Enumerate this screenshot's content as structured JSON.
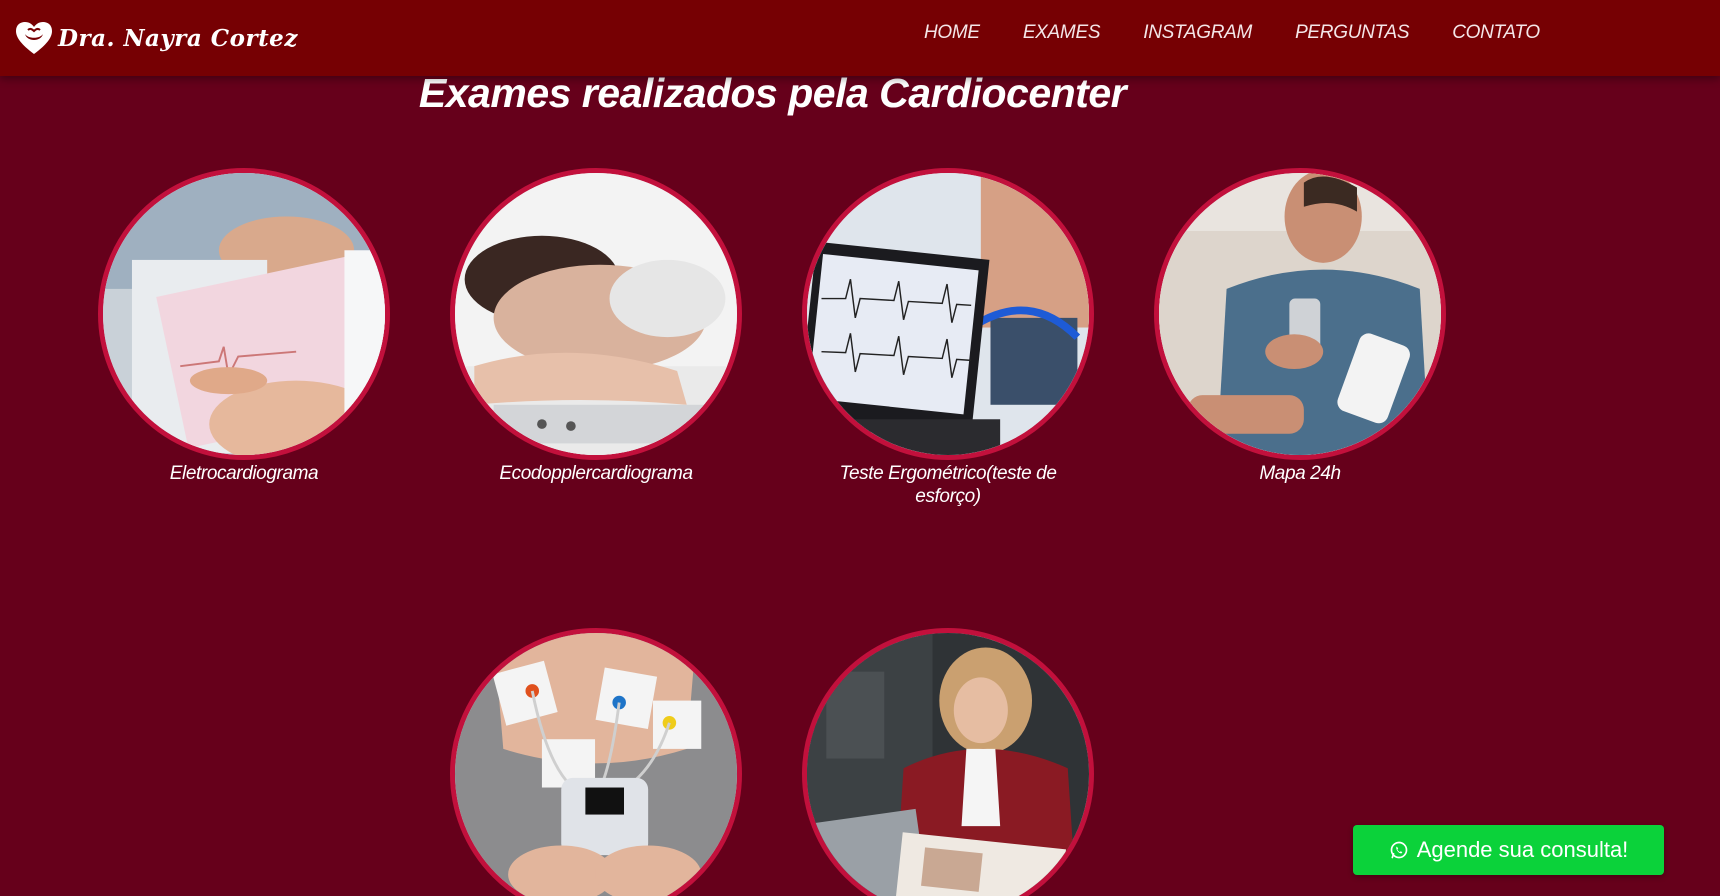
{
  "header": {
    "logo_text": "Dra. Nayra Cortez",
    "nav": [
      {
        "label": "HOME"
      },
      {
        "label": "EXAMES"
      },
      {
        "label": "INSTAGRAM"
      },
      {
        "label": "PERGUNTAS"
      },
      {
        "label": "CONTATO"
      }
    ]
  },
  "section": {
    "title": "Exames realizados pela Cardiocenter",
    "exams": [
      {
        "label": "Eletrocardiograma"
      },
      {
        "label": "Ecodopplercardiograma"
      },
      {
        "label": "Teste Ergométrico(teste de esforço)"
      },
      {
        "label": "Mapa 24h"
      },
      {
        "label": ""
      },
      {
        "label": ""
      }
    ]
  },
  "cta": {
    "label": "Agende sua consulta!",
    "icon": "whatsapp-icon"
  },
  "colors": {
    "header_bg": "#760003",
    "page_bg": "#66001b",
    "circle_border": "#c2103c",
    "cta_bg": "#0bd23a"
  }
}
